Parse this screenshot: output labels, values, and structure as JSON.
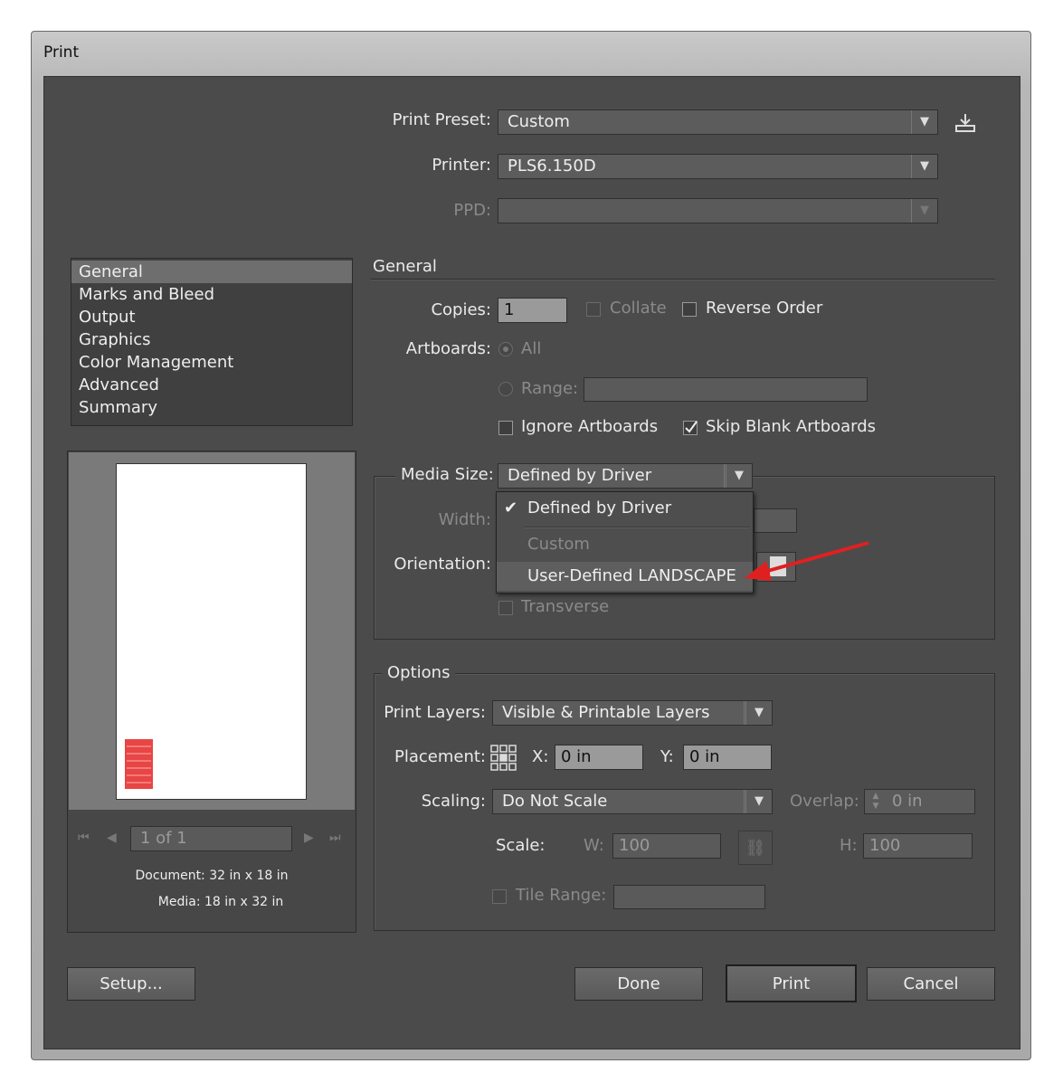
{
  "window": {
    "title": "Print"
  },
  "top": {
    "print_preset_label": "Print Preset:",
    "print_preset_value": "Custom",
    "printer_label": "Printer:",
    "printer_value": "PLS6.150D",
    "ppd_label": "PPD:",
    "ppd_value": ""
  },
  "sidebar": {
    "items": [
      {
        "label": "General",
        "selected": true
      },
      {
        "label": "Marks and Bleed"
      },
      {
        "label": "Output"
      },
      {
        "label": "Graphics"
      },
      {
        "label": "Color Management"
      },
      {
        "label": "Advanced"
      },
      {
        "label": "Summary"
      }
    ]
  },
  "preview": {
    "page_indicator": "1 of 1",
    "document_text": "Document: 32 in x 18 in",
    "media_text": "Media: 18 in x 32 in",
    "mark_color": "#e84545"
  },
  "general": {
    "section_title": "General",
    "copies_label": "Copies:",
    "copies_value": "1",
    "collate_label": "Collate",
    "reverse_order_label": "Reverse Order",
    "artboards_label": "Artboards:",
    "all_label": "All",
    "range_label": "Range:",
    "range_value": "",
    "ignore_artboards_label": "Ignore Artboards",
    "skip_blank_label": "Skip Blank Artboards",
    "skip_blank_checked": true
  },
  "media": {
    "media_size_label": "Media Size:",
    "media_size_value": "Defined by Driver",
    "width_label": "Width:",
    "orientation_label": "Orientation:",
    "transverse_label": "Transverse",
    "dropdown_options": [
      {
        "label": "Defined by Driver",
        "checked": true
      },
      {
        "label": "Custom",
        "disabled": true
      },
      {
        "label": "User-Defined LANDSCAPE",
        "highlighted": true
      }
    ]
  },
  "options": {
    "section_title": "Options",
    "print_layers_label": "Print Layers:",
    "print_layers_value": "Visible & Printable Layers",
    "placement_label": "Placement:",
    "x_label": "X:",
    "x_value": "0 in",
    "y_label": "Y:",
    "y_value": "0 in",
    "scaling_label": "Scaling:",
    "scaling_value": "Do Not Scale",
    "overlap_label": "Overlap:",
    "overlap_value": "0 in",
    "scale_label": "Scale:",
    "w_label": "W:",
    "w_value": "100",
    "h_label": "H:",
    "h_value": "100",
    "tile_range_label": "Tile Range:",
    "tile_range_value": ""
  },
  "buttons": {
    "setup": "Setup...",
    "done": "Done",
    "print": "Print",
    "cancel": "Cancel"
  },
  "annotation": {
    "arrow_color": "#e02020"
  }
}
